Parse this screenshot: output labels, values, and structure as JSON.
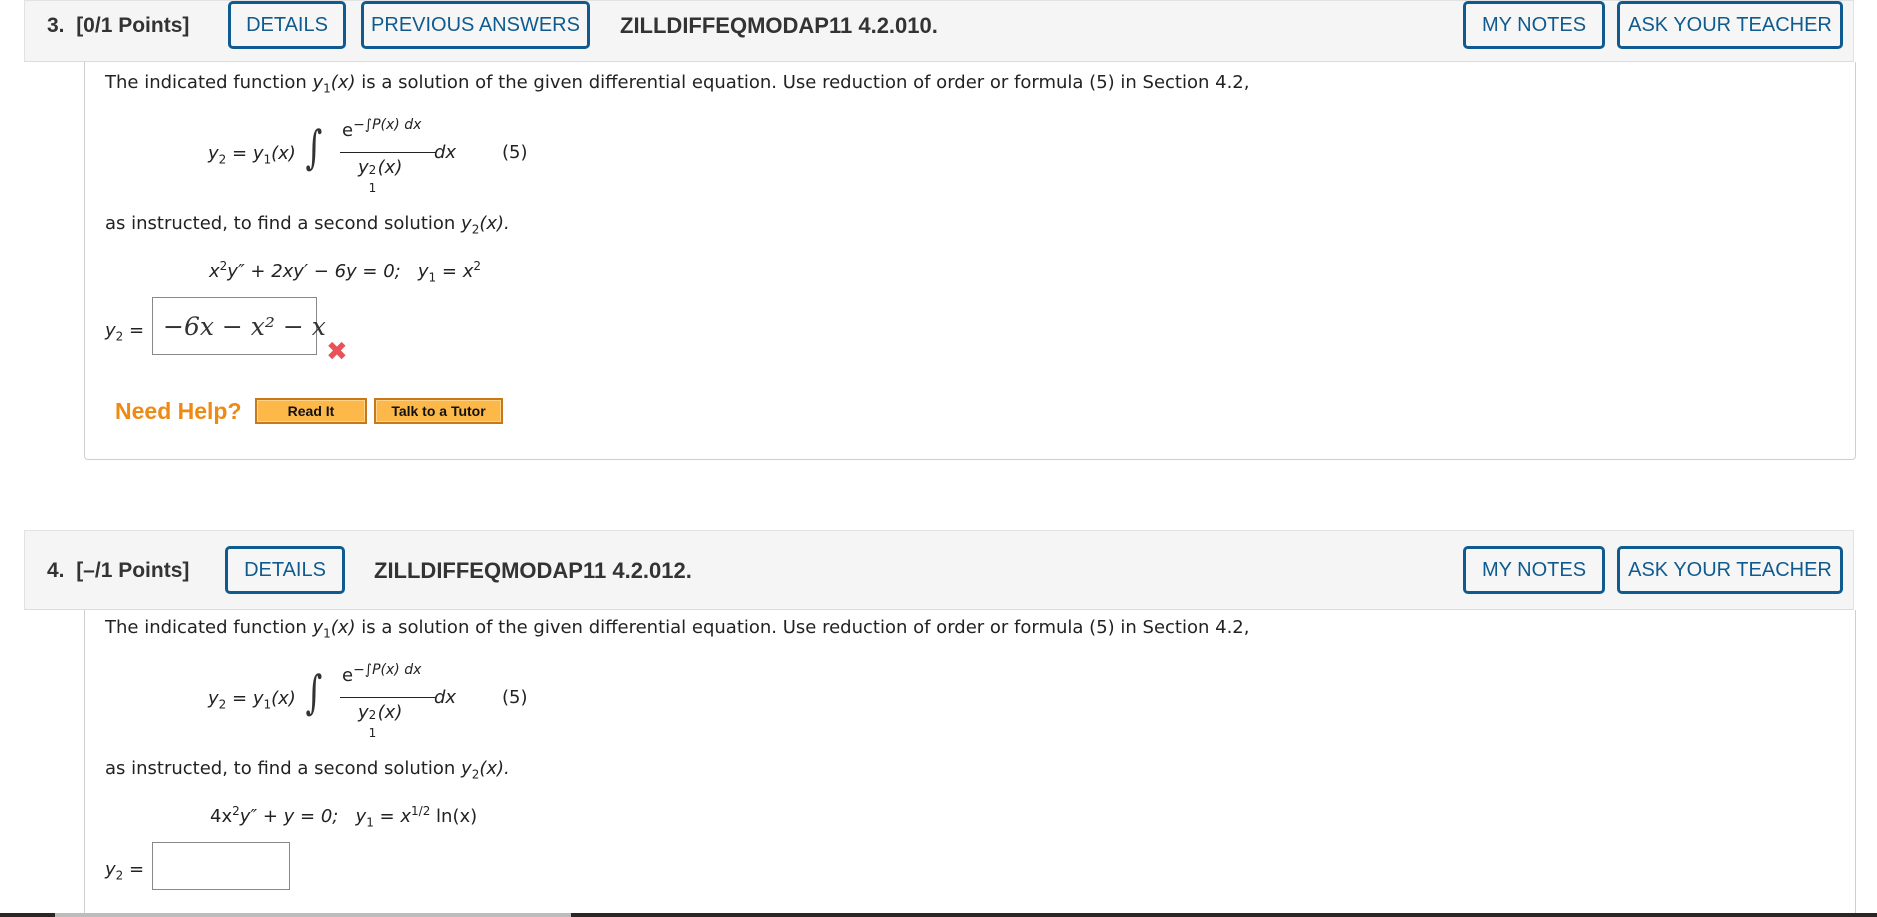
{
  "questions": [
    {
      "number": "3.",
      "points": "[0/1 Points]",
      "details_label": "DETAILS",
      "previous_answers_label": "PREVIOUS ANSWERS",
      "code": "ZILLDIFFEQMODAP11 4.2.010.",
      "my_notes_label": "MY NOTES",
      "ask_teacher_label": "ASK YOUR TEACHER",
      "intro_pre": "The indicated function ",
      "intro_fn": "y",
      "intro_fn_sub": "1",
      "intro_fn_arg": "(x)",
      "intro_post": " is a solution of the given differential equation. Use reduction of order or formula (5) in Section 4.2,",
      "formula": {
        "lhs": "y",
        "lhs_sub": "2",
        "eq": " = ",
        "y1": "y",
        "y1_sub": "1",
        "y1_arg": "(x)",
        "integral": "∫",
        "num_base": "e",
        "num_exp": "−∫P(x) dx",
        "den_base": "y",
        "den_sup": "2",
        "den_sub": "1",
        "den_arg": "(x)",
        "dx": "dx",
        "label": "(5)"
      },
      "instructed_pre": "as instructed, to find a second solution ",
      "instructed_fn": "y",
      "instructed_sub": "2",
      "instructed_arg": "(x).",
      "equation": {
        "part1": "x",
        "part1_sup": "2",
        "part2": "y″ + 2xy′ − 6y = 0;",
        "y1": "y",
        "y1_sub": "1",
        "rhs": " = x",
        "rhs_sup": "2"
      },
      "answer_label": "y",
      "answer_label_sub": "2",
      "answer_eq": " =",
      "answer_value": "−6x − x² − x",
      "answer_status": "incorrect",
      "need_help": "Need Help?",
      "read_it_label": "Read It",
      "tutor_label": "Talk to a Tutor"
    },
    {
      "number": "4.",
      "points": "[–/1 Points]",
      "details_label": "DETAILS",
      "code": "ZILLDIFFEQMODAP11 4.2.012.",
      "my_notes_label": "MY NOTES",
      "ask_teacher_label": "ASK YOUR TEACHER",
      "intro_pre": "The indicated function ",
      "intro_fn": "y",
      "intro_fn_sub": "1",
      "intro_fn_arg": "(x)",
      "intro_post": " is a solution of the given differential equation. Use reduction of order or formula (5) in Section 4.2,",
      "formula": {
        "lhs": "y",
        "lhs_sub": "2",
        "eq": " = ",
        "y1": "y",
        "y1_sub": "1",
        "y1_arg": "(x)",
        "integral": "∫",
        "num_base": "e",
        "num_exp": "−∫P(x) dx",
        "den_base": "y",
        "den_sup": "2",
        "den_sub": "1",
        "den_arg": "(x)",
        "dx": "dx",
        "label": "(5)"
      },
      "instructed_pre": "as instructed, to find a second solution ",
      "instructed_fn": "y",
      "instructed_sub": "2",
      "instructed_arg": "(x).",
      "equation": {
        "part1": "4x",
        "part1_sup": "2",
        "part2": "y″ + y = 0;",
        "y1": "y",
        "y1_sub": "1",
        "rhs": " = x",
        "rhs_sup": "1/2",
        "rhs_tail": " ln(x)"
      },
      "answer_label": "y",
      "answer_label_sub": "2",
      "answer_eq": " =",
      "answer_value": ""
    }
  ],
  "colors": {
    "accent": "#0f5b8f",
    "help_orange": "#ee8a14",
    "help_button": "#fdb84a",
    "incorrect": "#e8535a"
  }
}
